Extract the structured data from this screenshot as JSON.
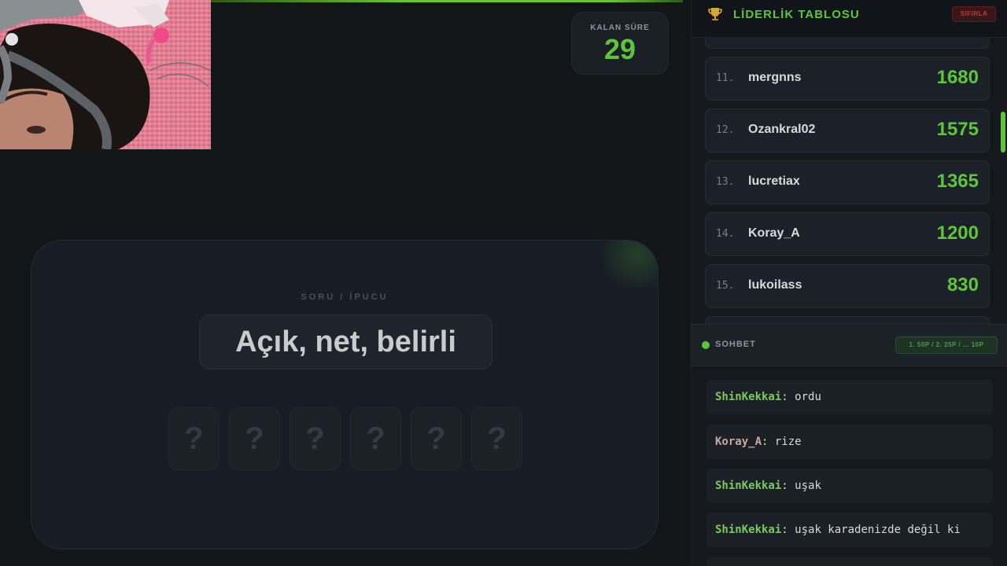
{
  "timer": {
    "label": "KALAN SÜRE",
    "value": "29"
  },
  "card": {
    "label": "SORU / İPUCU",
    "clue": "Açık, net, belirli",
    "tiles": [
      "?",
      "?",
      "?",
      "?",
      "?",
      "?"
    ]
  },
  "leaderboard": {
    "title": "LİDERLİK TABLOSU",
    "reset_label": "SIFIRLA",
    "rows": [
      {
        "rank": "11.",
        "name": "mergnns",
        "score": "1680"
      },
      {
        "rank": "12.",
        "name": "Ozankral02",
        "score": "1575"
      },
      {
        "rank": "13.",
        "name": "lucretiax",
        "score": "1365"
      },
      {
        "rank": "14.",
        "name": "Koray_A",
        "score": "1200"
      },
      {
        "rank": "15.",
        "name": "lukoilass",
        "score": "830"
      }
    ]
  },
  "chat": {
    "title": "SOHBET",
    "badge": "1. 50P / 2. 25P / ... 10P",
    "messages": [
      {
        "user": "ShinKekkai",
        "text": "ordu",
        "user_color": "#7ac95a"
      },
      {
        "user": "Koray_A",
        "text": "rize",
        "user_color": "#c9a8a0"
      },
      {
        "user": "ShinKekkai",
        "text": "uşak",
        "user_color": "#7ac95a"
      },
      {
        "user": "ShinKekkai",
        "text": "uşak karadenizde değil ki",
        "user_color": "#7ac95a"
      }
    ]
  },
  "colors": {
    "accent": "#5ec53a",
    "reset": "#c0393f"
  }
}
